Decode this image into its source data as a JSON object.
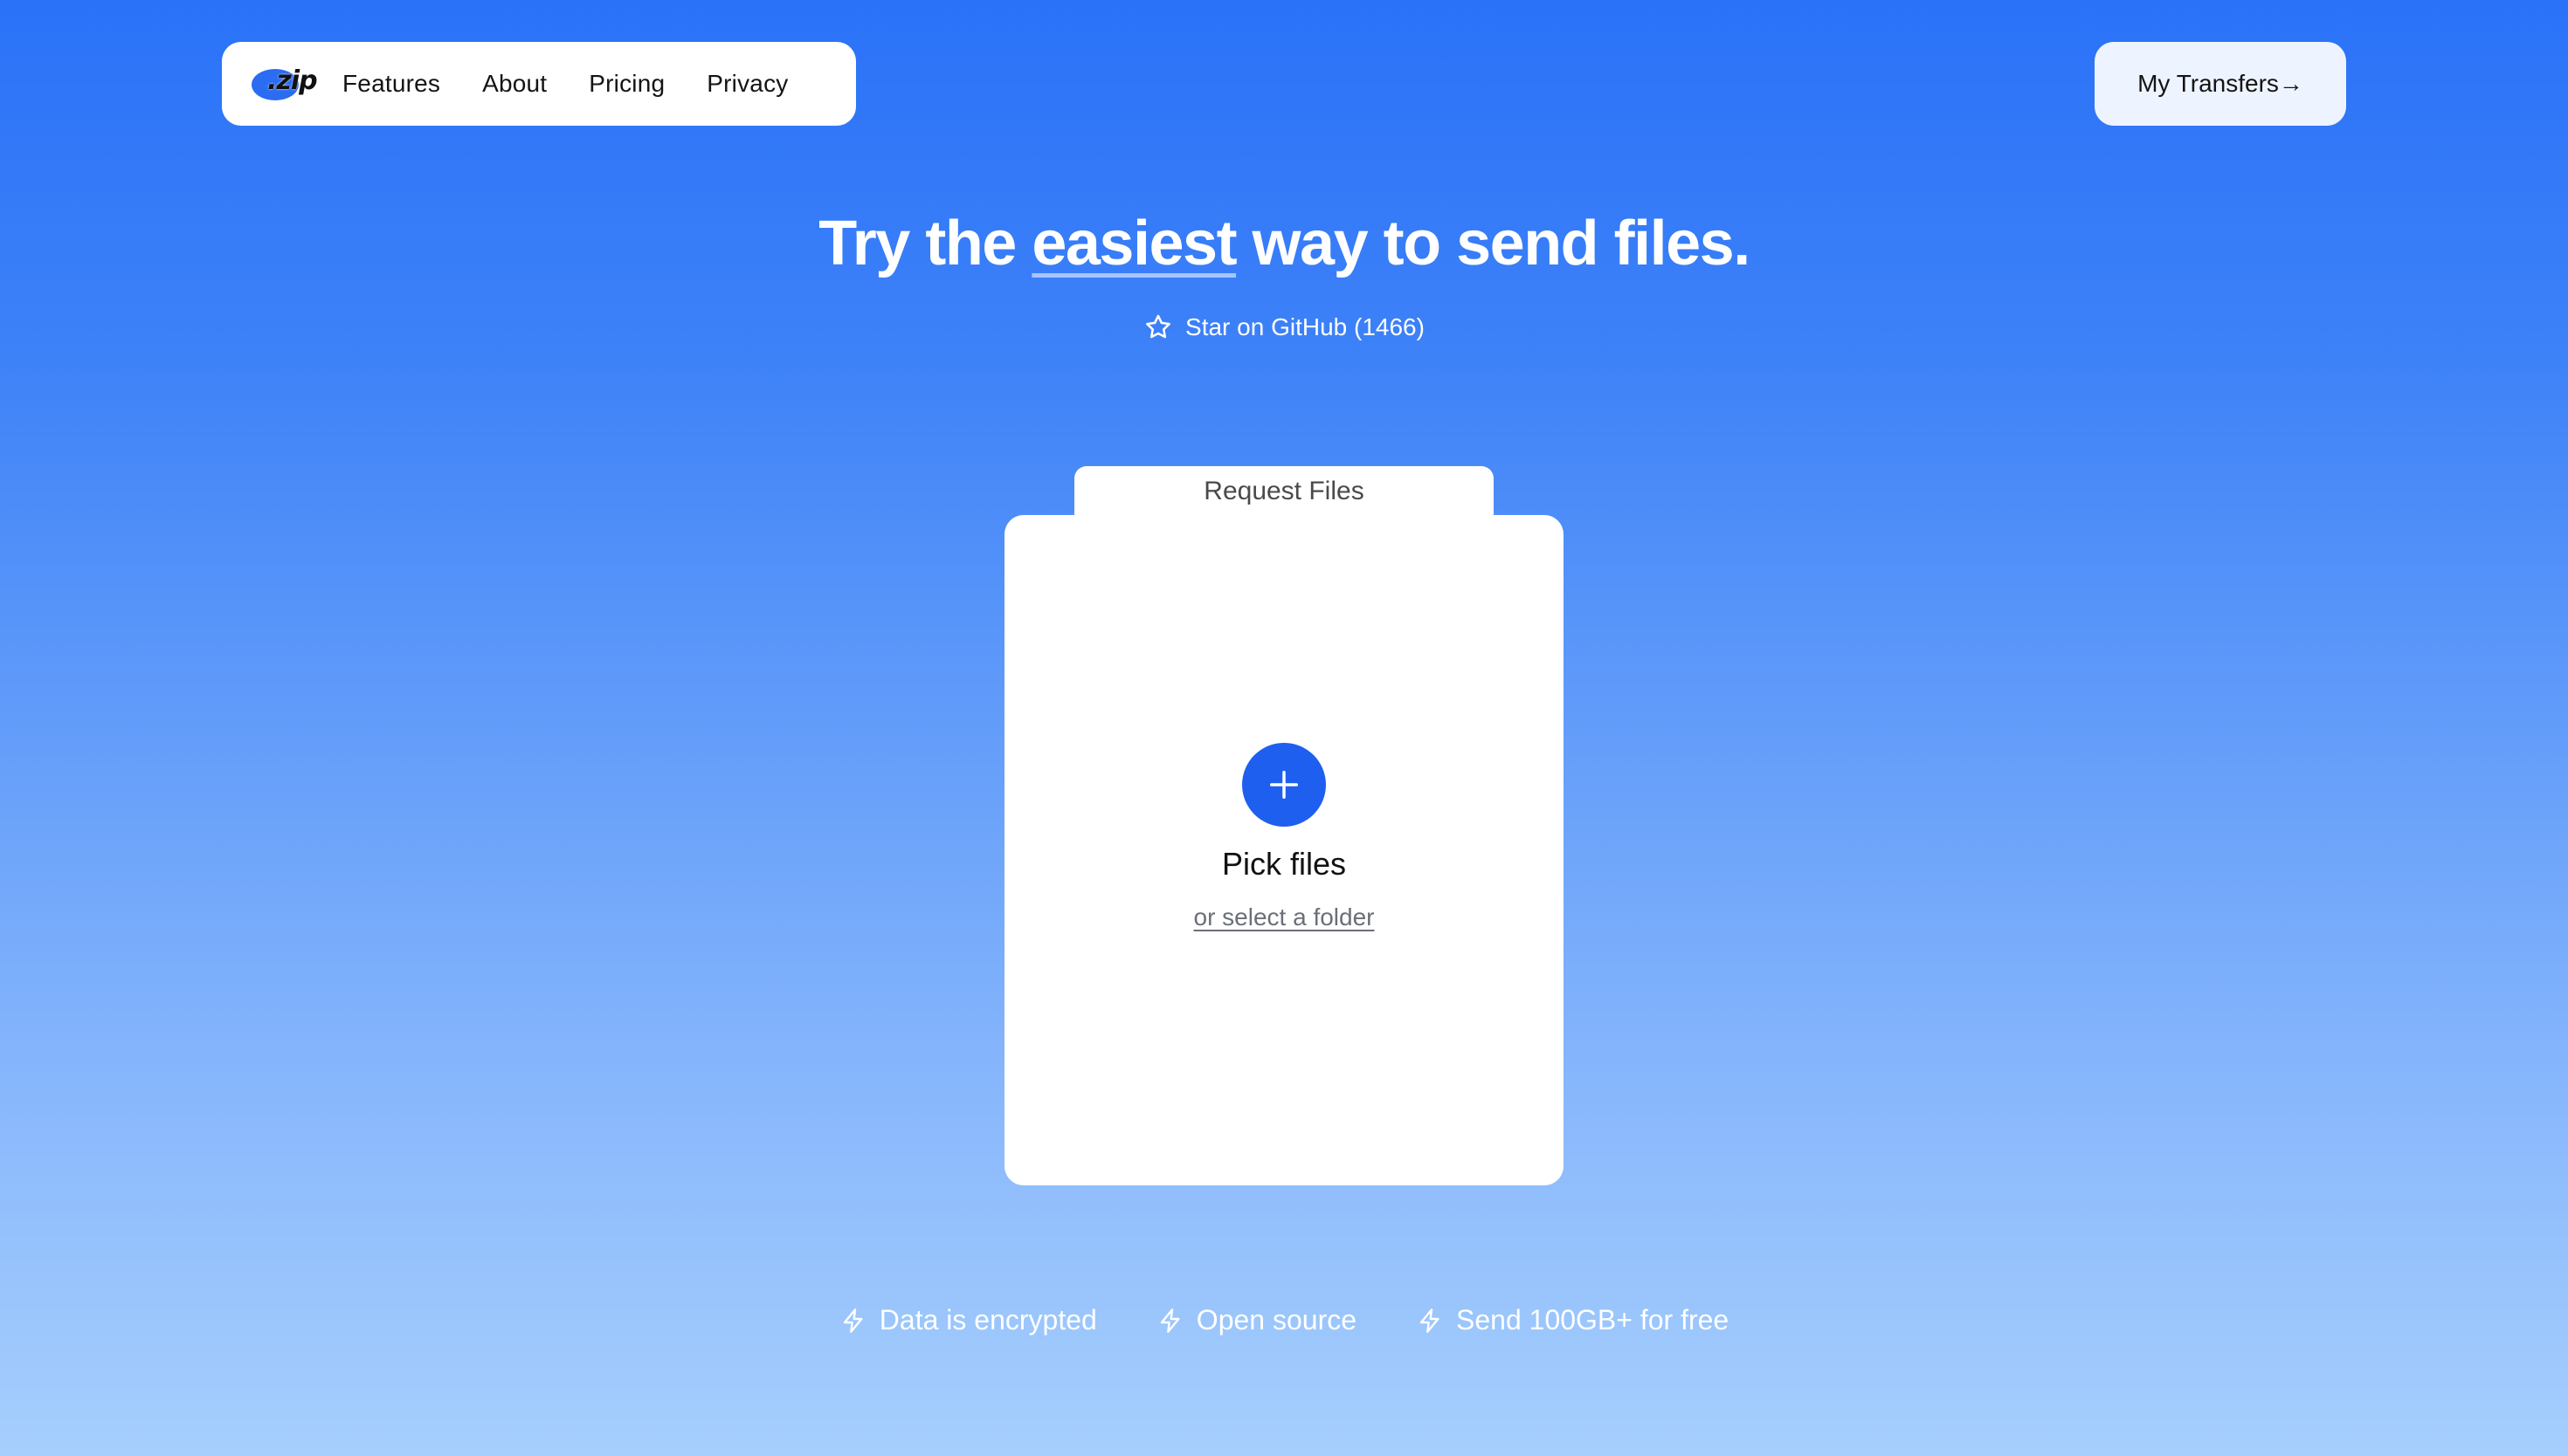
{
  "nav": {
    "logo_text": ".zip",
    "links": [
      {
        "label": "Features"
      },
      {
        "label": "About"
      },
      {
        "label": "Pricing"
      },
      {
        "label": "Privacy"
      }
    ],
    "transfers_label": "My Transfers→"
  },
  "hero": {
    "title_prefix": "Try the ",
    "title_emphasis": "easiest",
    "title_suffix": " way to send files.",
    "github_label": "Star on GitHub (1466)"
  },
  "upload": {
    "request_tab_label": "Request Files",
    "pick_label": "Pick files",
    "folder_label": "or select a folder"
  },
  "features": [
    {
      "label": "Data is encrypted",
      "icon": "bolt-icon"
    },
    {
      "label": "Open source",
      "icon": "bolt-icon"
    },
    {
      "label": "Send 100GB+ for free",
      "icon": "bolt-icon"
    }
  ],
  "colors": {
    "accent": "#1f5ff0",
    "background_top": "#2a72f8",
    "background_bottom": "#a6cffd"
  }
}
